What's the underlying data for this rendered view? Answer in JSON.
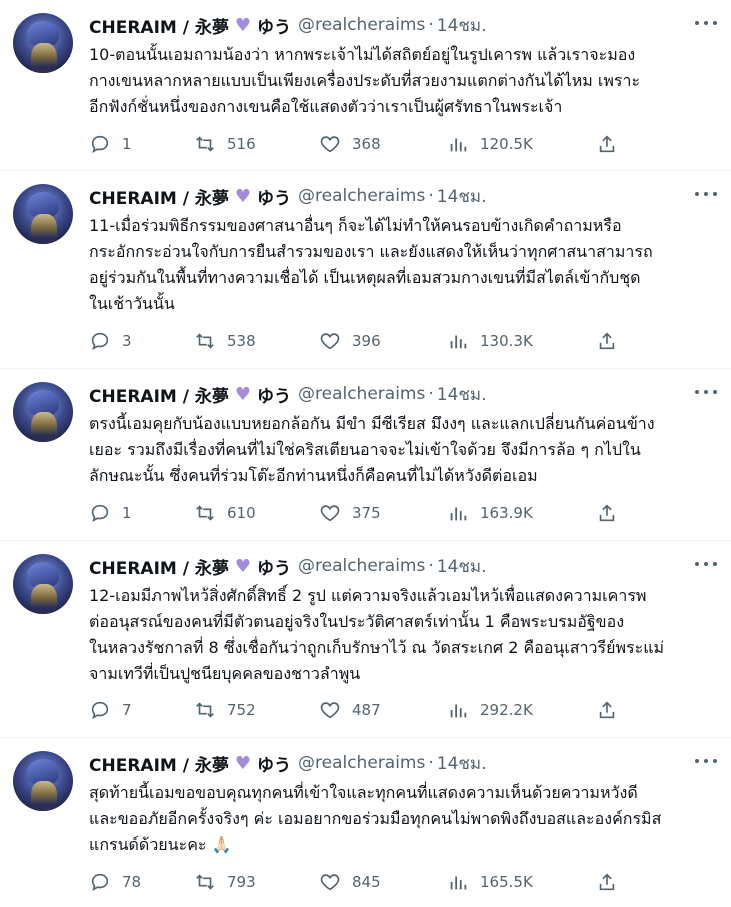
{
  "author": {
    "name": "CHERAIM / 永夢",
    "name_suffix": "ゆう",
    "handle": "@realcheraims",
    "separator": "·",
    "heart_color": "#a78bdb"
  },
  "tweets": [
    {
      "time": "14ชม.",
      "text": "10-ตอนนั้นเอมถามน้องว่า หากพระเจ้าไม่ได้สถิตย์อยู่ในรูปเคารพ แล้วเราจะมอง\nกางเขนหลากหลายแบบเป็นเพียงเครื่องประดับที่สวยงามแตกต่างกันได้ไหม เพราะ\nอีกฟังก์ชั่นหนึ่งของกางเขนคือใช้แสดงตัวว่าเราเป็นผู้ศรัทธาในพระเจ้า",
      "replies": "1",
      "retweets": "516",
      "likes": "368",
      "views": "120.5K"
    },
    {
      "time": "14ชม.",
      "text": "11-เมื่อร่วมพิธีกรรมของศาสนาอื่นๆ ก็จะได้ไม่ทำให้คนรอบข้างเกิดคำถามหรือ\nกระอักกระอ่วนใจกับการยืนสำรวมของเรา และยังแสดงให้เห็นว่าทุกศาสนาสามารถ\nอยู่ร่วมกันในพื้นที่ทางความเชื่อได้ เป็นเหตุผลที่เอมสวมกางเขนที่มีสไตล์เข้ากับชุด\nในเช้าวันนั้น",
      "replies": "3",
      "retweets": "538",
      "likes": "396",
      "views": "130.3K"
    },
    {
      "time": "14ชม.",
      "text": "ตรงนี้เอมคุยกับน้องแบบหยอกล้อกัน มีขำ มีซีเรียส มึงงๆ และแลกเปลี่ยนกันค่อนข้าง\nเยอะ รวมถึงมีเรื่องที่คนที่ไม่ใช่คริสเตียนอาจจะไม่เข้าใจด้วย จึงมีการล้อ ๆ กไปใน\nลักษณะนั้น ซึ่งคนที่ร่วมโต๊ะอีกท่านหนึ่งก็คือคนที่ไม่ได้หวังดีต่อเอม",
      "replies": "1",
      "retweets": "610",
      "likes": "375",
      "views": "163.9K"
    },
    {
      "time": "14ชม.",
      "text": "12-เอมมีภาพไหว้สิ่งศักดิ์สิทธิ์ 2 รูป แต่ความจริงแล้วเอมไหว้เพื่อแสดงความเคารพ\nต่ออนุสรณ์ของคนที่มีตัวตนอยู่จริงในประวัติศาสตร์เท่านั้น 1 คือพระบรมอัฐิของ\nในหลวงรัชกาลที่ 8 ซึ่งเชื่อกันว่าถูกเก็บรักษาไว้ ณ วัดสระเกศ 2 คืออนุเสาวรีย์พระแม่\nจามเทวีที่เป็นปูชนียบุคคลของชาวลำพูน",
      "replies": "7",
      "retweets": "752",
      "likes": "487",
      "views": "292.2K"
    },
    {
      "time": "14ชม.",
      "text": "สุดท้ายนี้เอมขอขอบคุณทุกคนที่เข้าใจและทุกคนที่แสดงความเห็นด้วยความหวังดี\nและขออภัยอีกครั้งจริงๆ ค่ะ เอมอยากขอร่วมมือทุกคนไม่พาดพิงถึงบอสและองค์กรมิส\nแกรนด์ด้วยนะคะ 🙏🏻",
      "replies": "78",
      "retweets": "793",
      "likes": "845",
      "views": "165.5K"
    }
  ]
}
